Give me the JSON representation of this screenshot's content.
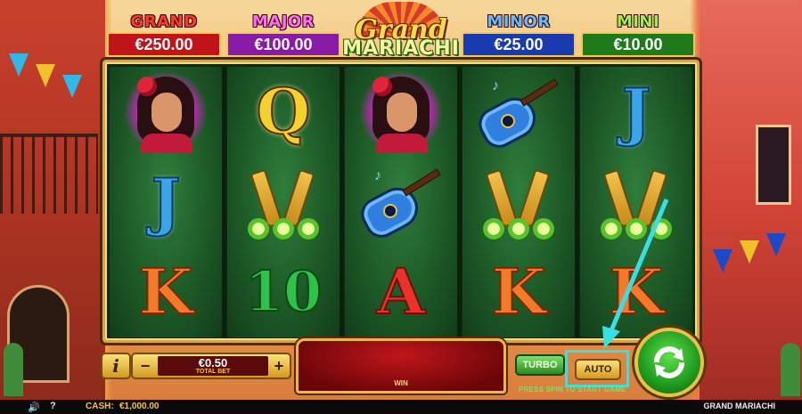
{
  "game": {
    "title": "GRAND MARIACHI",
    "logo_line1": "Grand",
    "logo_line2": "MARIACHI"
  },
  "jackpots": [
    {
      "label": "GRAND",
      "value": "€250.00",
      "label_color": "#ff3a2a",
      "box_color": "#c0141a"
    },
    {
      "label": "MAJOR",
      "value": "€100.00",
      "label_color": "#ff6bff",
      "box_color": "#8a1aa8"
    },
    {
      "label": "MINOR",
      "value": "€25.00",
      "label_color": "#6ab8ff",
      "box_color": "#1a3ab0"
    },
    {
      "label": "MINI",
      "value": "€10.00",
      "label_color": "#9cf04a",
      "box_color": "#1e7a1a"
    }
  ],
  "reels": [
    [
      "lady-wild",
      "J",
      "K"
    ],
    [
      "Q",
      "bottles",
      "10"
    ],
    [
      "lady-wild",
      "guitar",
      "A"
    ],
    [
      "guitar",
      "bottles",
      "K"
    ],
    [
      "J",
      "bottles",
      "K"
    ]
  ],
  "symbol_text": {
    "Q": "Q",
    "J": "J",
    "K": "K",
    "A": "A",
    "10": "10"
  },
  "bet": {
    "value": "€0.50",
    "label": "TOTAL BET",
    "minus": "−",
    "plus": "+"
  },
  "info_label": "i",
  "win": {
    "label": "WIN"
  },
  "turbo_label": "TURBO",
  "auto_label": "AUTO",
  "hint": "PRESS SPIN TO START GAME",
  "status": {
    "cash_label": "CASH:",
    "cash_value": "€1,000.00",
    "help": "?",
    "volume": "🔊"
  },
  "colors": {
    "highlight": "#38e0e6",
    "gold": "#e8c14a",
    "spin": "#1f9a1e"
  }
}
